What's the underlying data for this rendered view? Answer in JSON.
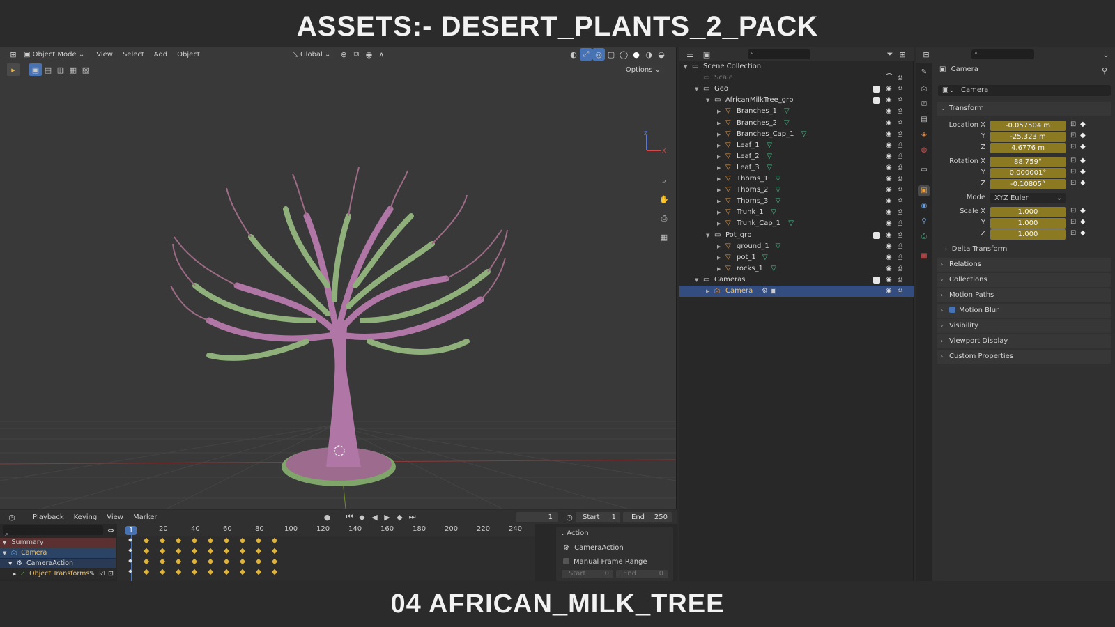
{
  "banners": {
    "top": "ASSETS:- DESERT_PLANTS_2_PACK",
    "bottom": "04 AFRICAN_MILK_TREE"
  },
  "viewport": {
    "mode": "Object Mode",
    "menus": [
      "View",
      "Select",
      "Add",
      "Object"
    ],
    "orientation": "Global",
    "options_label": "Options",
    "nav_icons": [
      "zoom-icon",
      "hand-pan-icon",
      "camera-view-icon",
      "grid-ortho-icon"
    ],
    "gizmo_axes": [
      "Z",
      "X"
    ]
  },
  "outliner": {
    "search_placeholder": "",
    "rows": [
      {
        "label": "Scene Collection",
        "depth": 0,
        "kind": "collection",
        "expanded": true
      },
      {
        "label": "Scale",
        "depth": 1,
        "kind": "collection-dim"
      },
      {
        "label": "Geo",
        "depth": 1,
        "kind": "collection",
        "expanded": true,
        "checked": true
      },
      {
        "label": "AfricanMilkTree_grp",
        "depth": 2,
        "kind": "collection",
        "expanded": true,
        "checked": true
      },
      {
        "label": "Branches_1",
        "depth": 3,
        "kind": "mesh"
      },
      {
        "label": "Branches_2",
        "depth": 3,
        "kind": "mesh"
      },
      {
        "label": "Branches_Cap_1",
        "depth": 3,
        "kind": "mesh"
      },
      {
        "label": "Leaf_1",
        "depth": 3,
        "kind": "mesh"
      },
      {
        "label": "Leaf_2",
        "depth": 3,
        "kind": "mesh"
      },
      {
        "label": "Leaf_3",
        "depth": 3,
        "kind": "mesh"
      },
      {
        "label": "Thorns_1",
        "depth": 3,
        "kind": "mesh"
      },
      {
        "label": "Thorns_2",
        "depth": 3,
        "kind": "mesh"
      },
      {
        "label": "Thorns_3",
        "depth": 3,
        "kind": "mesh"
      },
      {
        "label": "Trunk_1",
        "depth": 3,
        "kind": "mesh"
      },
      {
        "label": "Trunk_Cap_1",
        "depth": 3,
        "kind": "mesh"
      },
      {
        "label": "Pot_grp",
        "depth": 2,
        "kind": "collection",
        "expanded": true,
        "checked": true
      },
      {
        "label": "ground_1",
        "depth": 3,
        "kind": "mesh"
      },
      {
        "label": "pot_1",
        "depth": 3,
        "kind": "mesh"
      },
      {
        "label": "rocks_1",
        "depth": 3,
        "kind": "mesh"
      },
      {
        "label": "Cameras",
        "depth": 1,
        "kind": "collection",
        "expanded": true,
        "checked": true
      },
      {
        "label": "Camera",
        "depth": 2,
        "kind": "camera",
        "selected": true
      }
    ]
  },
  "properties": {
    "header_object": "Camera",
    "datablock_name": "Camera",
    "transform_label": "Transform",
    "location_label": "Location X",
    "rotation_label": "Rotation X",
    "scale_label": "Scale X",
    "y_label": "Y",
    "z_label": "Z",
    "location": [
      "-0.057504 m",
      "-25.323 m",
      "4.6776 m"
    ],
    "rotation": [
      "88.759°",
      "0.000001°",
      "-0.10805°"
    ],
    "mode_label": "Mode",
    "mode_value": "XYZ Euler",
    "scale": [
      "1.000",
      "1.000",
      "1.000"
    ],
    "delta_transform": "Delta Transform",
    "panels": [
      "Relations",
      "Collections",
      "Motion Paths",
      "Motion Blur",
      "Visibility",
      "Viewport Display",
      "Custom Properties"
    ],
    "motion_blur_checked": true,
    "field_color": "#8c7a23"
  },
  "timeline": {
    "menus": [
      "Playback",
      "Keying",
      "View",
      "Marker"
    ],
    "current_frame": "1",
    "start_label": "Start",
    "start_value": "1",
    "end_label": "End",
    "end_value": "250",
    "ticks": [
      "1",
      "20",
      "40",
      "60",
      "80",
      "100",
      "120",
      "140",
      "160",
      "180",
      "200",
      "220",
      "240"
    ],
    "channels": [
      "Summary",
      "Camera",
      "CameraAction",
      "Object Transforms"
    ],
    "action_panel": {
      "title": "Action",
      "action_name": "CameraAction",
      "manual_frame_range": "Manual Frame Range",
      "start_label": "Start",
      "start_value": "0",
      "end_label": "End",
      "end_value": "0"
    }
  }
}
